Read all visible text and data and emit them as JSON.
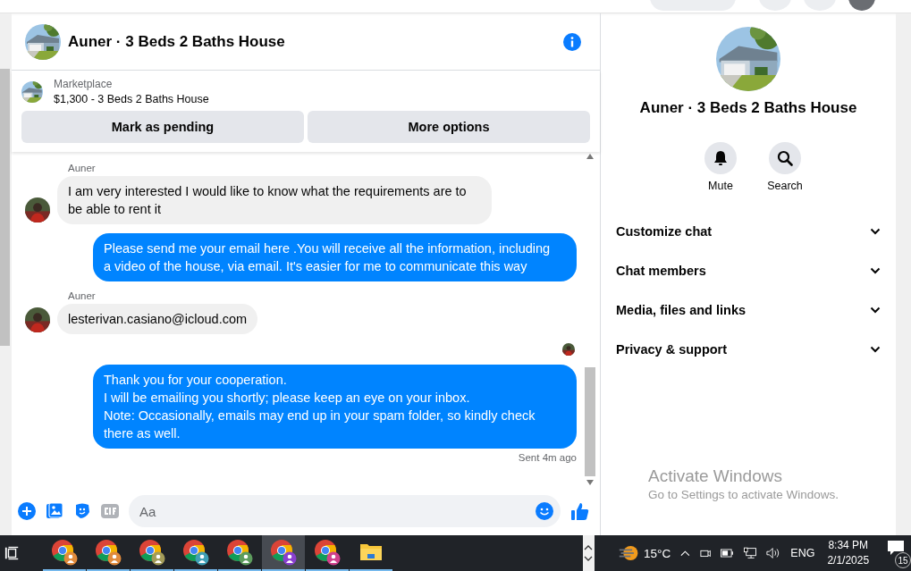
{
  "chat": {
    "title": "Auner · 3 Beds 2 Baths House",
    "listing": {
      "source": "Marketplace",
      "summary": "$1,300 - 3 Beds 2 Baths House"
    },
    "actions": [
      "Mark as pending",
      "More options"
    ],
    "messages": [
      {
        "kind": "incoming",
        "sender": "Auner",
        "text": "I am very interested I would like to know what the requirements are to be able to rent it"
      },
      {
        "kind": "outgoing",
        "text": "Please send me your email here .You will receive all the information, including a video of the house, via email. It's easier for me to communicate this way"
      },
      {
        "kind": "incoming",
        "sender": "Auner",
        "text": "lesterivan.casiano@icloud.com"
      },
      {
        "kind": "seen"
      },
      {
        "kind": "outgoing",
        "text": "Thank you for your cooperation.\nI will be emailing you shortly; please keep an eye on your inbox.\nNote: Occasionally, emails may end up in your spam folder, so kindly check there as well."
      }
    ],
    "status": "Sent 4m ago",
    "composer": {
      "placeholder": "Aa"
    }
  },
  "details": {
    "title": "Auner · 3 Beds 2 Baths House",
    "actions": [
      {
        "kind": "bell",
        "label": "Mute"
      },
      {
        "kind": "search",
        "label": "Search"
      }
    ],
    "sections": [
      {
        "label": "Customize chat",
        "expanded": false
      },
      {
        "label": "Chat members",
        "expanded": false
      },
      {
        "label": "Media, files and links",
        "expanded": false
      },
      {
        "label": "Privacy & support",
        "expanded": false
      }
    ]
  },
  "activation_notice": {
    "title": "Activate Windows",
    "hint": "Go to Settings to activate Windows."
  },
  "taskbar": {
    "apps": [
      {
        "kind": "browser",
        "color": "#e08a3c",
        "selected": false
      },
      {
        "kind": "browser",
        "color": "#e08a3c",
        "selected": false
      },
      {
        "kind": "browser",
        "color": "#a39b58",
        "selected": false
      },
      {
        "kind": "browser",
        "color": "#3f9fb5",
        "selected": false
      },
      {
        "kind": "browser",
        "color": "#5d9c5d",
        "selected": false
      },
      {
        "kind": "browser",
        "color": "#8a3fd0",
        "selected": true
      },
      {
        "kind": "browser",
        "color": "#d0408c",
        "selected": false
      },
      {
        "kind": "folder",
        "selected": false
      }
    ],
    "weather": "15°C",
    "language": "ENG",
    "time": "8:34 PM",
    "date": "2/1/2025",
    "notifications": "15"
  }
}
